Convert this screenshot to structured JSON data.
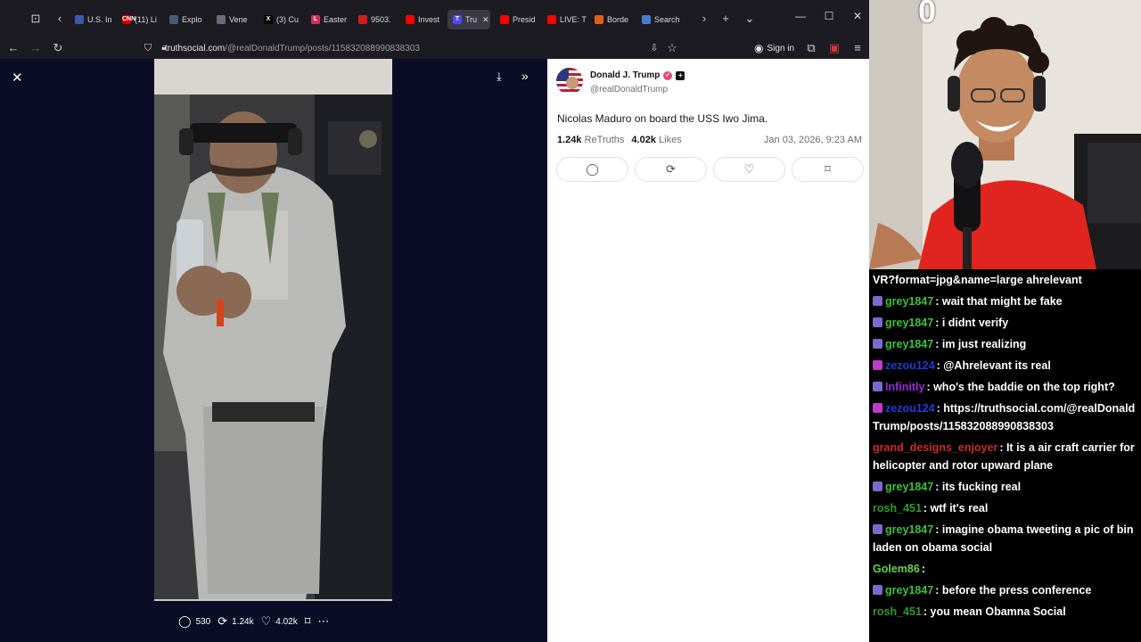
{
  "browser": {
    "tabs": [
      {
        "label": "U.S. In",
        "fav_color": "#3a5aa8",
        "fav_text": ""
      },
      {
        "label": "(11) Li",
        "fav_color": "#cc0000",
        "fav_text": "CNN"
      },
      {
        "label": "Explo",
        "fav_color": "#4a5a70",
        "fav_text": ""
      },
      {
        "label": "Vene",
        "fav_color": "#6a6a7a",
        "fav_text": ""
      },
      {
        "label": "(3) Cu",
        "fav_color": "#000000",
        "fav_text": "X"
      },
      {
        "label": "Easter",
        "fav_color": "#d0305a",
        "fav_text": "L"
      },
      {
        "label": "9503.",
        "fav_color": "#cc2020",
        "fav_text": ""
      },
      {
        "label": "Invest",
        "fav_color": "#ff0000",
        "fav_text": ""
      },
      {
        "label": "Tru",
        "fav_color": "#5448ee",
        "fav_text": "T",
        "active": true
      },
      {
        "label": "Presid",
        "fav_color": "#ff0000",
        "fav_text": ""
      },
      {
        "label": "LIVE: T",
        "fav_color": "#ff0000",
        "fav_text": ""
      },
      {
        "label": "Borde",
        "fav_color": "#e0601a",
        "fav_text": ""
      },
      {
        "label": "Search",
        "fav_color": "#4a7ad0",
        "fav_text": ""
      }
    ],
    "url_domain": "truthsocial.com",
    "url_path": "/@realDonaldTrump/posts/115832088990838303",
    "signin_label": "Sign in"
  },
  "media": {
    "replies": "530",
    "retruths": "1.24k",
    "likes": "4.02k"
  },
  "post": {
    "author": "Donald J. Trump",
    "handle": "@realDonaldTrump",
    "text": "Nicolas Maduro on board the USS Iwo Jima.",
    "retruths_count": "1.24k",
    "retruths_label": "ReTruths",
    "likes_count": "4.02k",
    "likes_label": "Likes",
    "date": "Jan 03, 2026, 9:23 AM"
  },
  "webcam": {
    "counter": "0"
  },
  "chat": {
    "top_fragment": "VR?format=jpg&name=large ahrelevant",
    "messages": [
      {
        "user": "grey1847",
        "color": "#39c439",
        "badge": "#7a6ad0",
        "text": ": wait that might be fake"
      },
      {
        "user": "grey1847",
        "color": "#39c439",
        "badge": "#7a6ad0",
        "text": ": i didnt verify"
      },
      {
        "user": "grey1847",
        "color": "#39c439",
        "badge": "#7a6ad0",
        "text": ": im just realizing"
      },
      {
        "user": "zezou124",
        "color": "#1e3cd6",
        "badge": "#c03acc",
        "text": ": @Ahrelevant its real"
      },
      {
        "user": "Infinitly",
        "color": "#9a2bd8",
        "badge": "#7a6ad0",
        "text": ": who's the baddie on the top right?"
      },
      {
        "user": "zezou124",
        "color": "#1e3cd6",
        "badge": "#c03acc",
        "text": ": https://truthsocial.com/@realDonaldTrump/posts/115832088990838303"
      },
      {
        "user": "grand_designs_enjoyer",
        "color": "#cc2a2a",
        "badge": "",
        "text": ": It is a air craft carrier for helicopter and rotor upward plane"
      },
      {
        "user": "grey1847",
        "color": "#39c439",
        "badge": "#7a6ad0",
        "text": ": its fucking real"
      },
      {
        "user": "rosh_451",
        "color": "#2e9a2e",
        "badge": "",
        "text": ": wtf it's real"
      },
      {
        "user": "grey1847",
        "color": "#39c439",
        "badge": "#7a6ad0",
        "text": ": imagine obama tweeting a pic of bin laden on obama social"
      },
      {
        "user": "Golem86",
        "color": "#6ad04a",
        "badge": "",
        "text": ":"
      },
      {
        "user": "grey1847",
        "color": "#39c439",
        "badge": "#7a6ad0",
        "text": ": before the press conference"
      },
      {
        "user": "rosh_451",
        "color": "#2e9a2e",
        "badge": "",
        "text": ": you mean Obamna Social"
      }
    ]
  }
}
